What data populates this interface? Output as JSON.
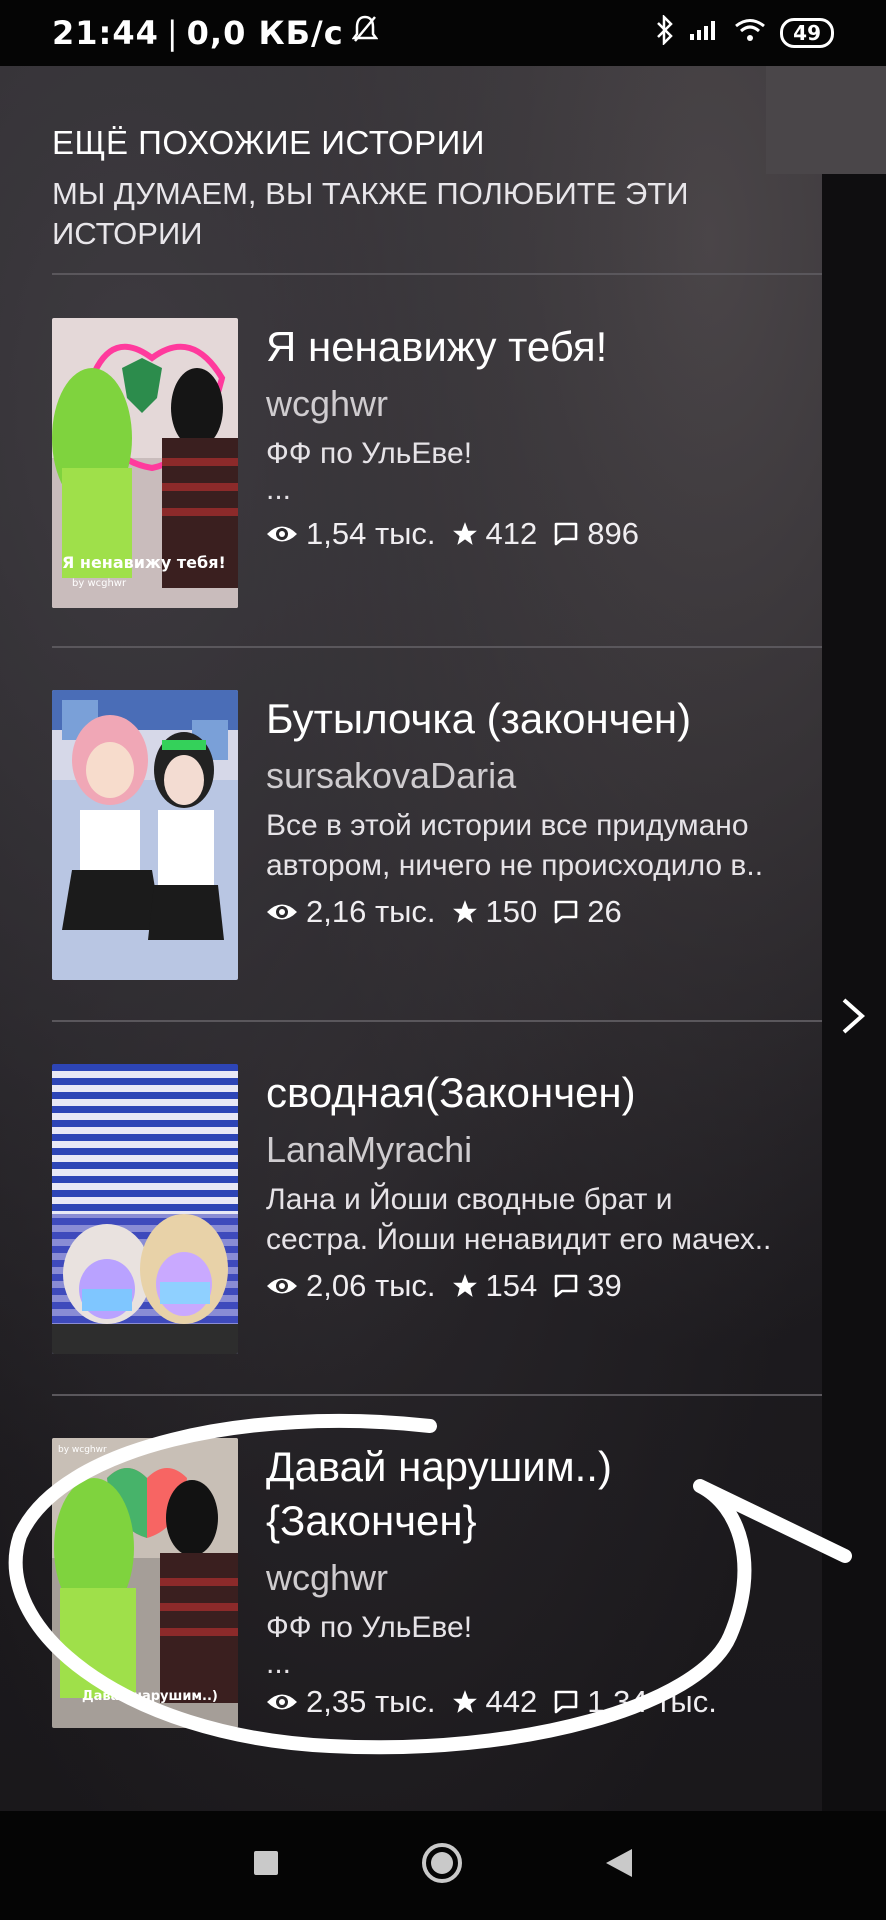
{
  "statusbar": {
    "time": "21:44",
    "network_speed": "0,0 КБ/с",
    "battery": "49"
  },
  "section": {
    "title": "ЕЩЁ ПОХОЖИЕ ИСТОРИИ",
    "subtitle": "МЫ ДУМАЕМ, ВЫ ТАКЖЕ ПОЛЮБИТЕ ЭТИ ИСТОРИИ"
  },
  "stories": [
    {
      "title": "Я ненавижу тебя!",
      "author": "wcghwr",
      "description_lines": [
        "ФФ по УльЕве!",
        "..."
      ],
      "views": "1,54 тыс.",
      "stars": "412",
      "comments": "896",
      "cover_caption": "Я ненавижу тебя!",
      "cover_byline": "by wcghwr"
    },
    {
      "title": "Бутылочка (закончен)",
      "author": "sursakovaDaria",
      "description_lines": [
        "Все в этой истории все придумано",
        "автором, ничего не происходило в.."
      ],
      "views": "2,16 тыс.",
      "stars": "150",
      "comments": "26"
    },
    {
      "title": "сводная(Закончен)",
      "author": "LanaMyrachi",
      "description_lines": [
        "Лана и Йоши сводные брат и",
        "сестра. Йоши ненавидит его мачех.."
      ],
      "views": "2,06 тыс.",
      "stars": "154",
      "comments": "39"
    },
    {
      "title_lines": [
        "Давай нарушим..)",
        "{Закончен}"
      ],
      "author": "wcghwr",
      "description_lines": [
        "ФФ по УльЕве!",
        "..."
      ],
      "views": "2,35 тыс.",
      "stars": "442",
      "comments": "1,34 тыс.",
      "cover_caption": "Давай нарушим..)",
      "cover_byline": "by wcghwr"
    }
  ],
  "icons": {
    "views": "eye-icon",
    "stars": "star-icon",
    "comments": "comment-icon",
    "next": "chevron-right-icon",
    "nav_recents": "square-icon",
    "nav_home": "circle-icon",
    "nav_back": "triangle-back-icon"
  }
}
